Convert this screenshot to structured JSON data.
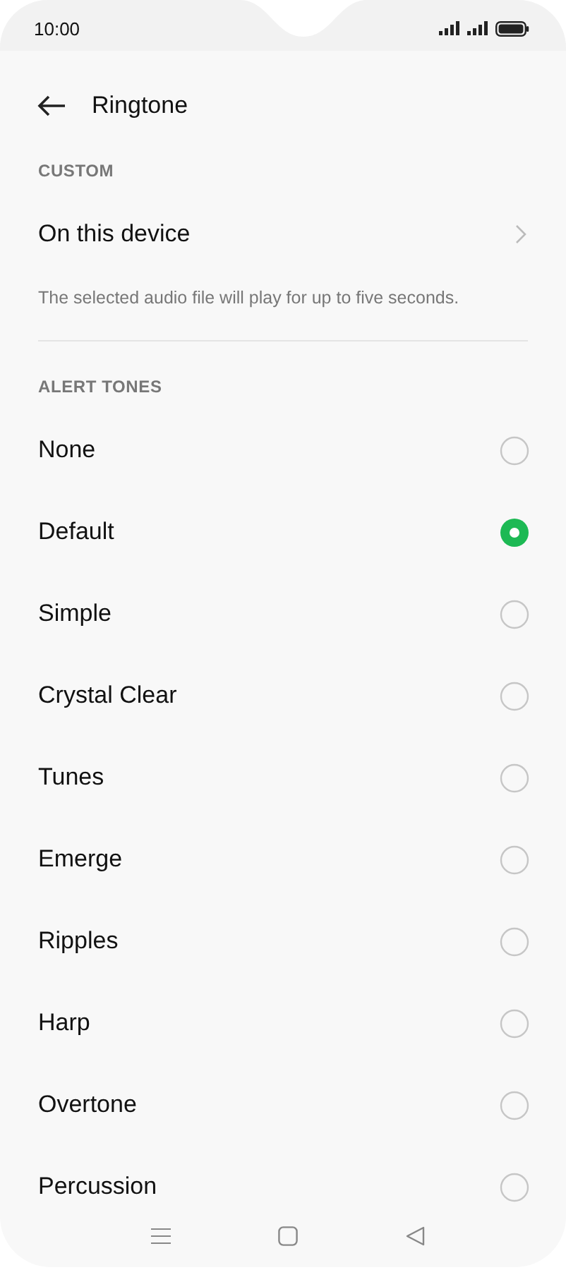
{
  "status_bar": {
    "time": "10:00"
  },
  "header": {
    "title": "Ringtone"
  },
  "custom": {
    "heading": "CUSTOM",
    "item": "On this device",
    "note": "The selected audio file will play for up to five seconds."
  },
  "alert_tones": {
    "heading": "ALERT TONES",
    "items": [
      {
        "label": "None",
        "selected": false
      },
      {
        "label": "Default",
        "selected": true
      },
      {
        "label": "Simple",
        "selected": false
      },
      {
        "label": "Crystal Clear",
        "selected": false
      },
      {
        "label": "Tunes",
        "selected": false
      },
      {
        "label": "Emerge",
        "selected": false
      },
      {
        "label": "Ripples",
        "selected": false
      },
      {
        "label": "Harp",
        "selected": false
      },
      {
        "label": "Overtone",
        "selected": false
      },
      {
        "label": "Percussion",
        "selected": false
      }
    ]
  }
}
